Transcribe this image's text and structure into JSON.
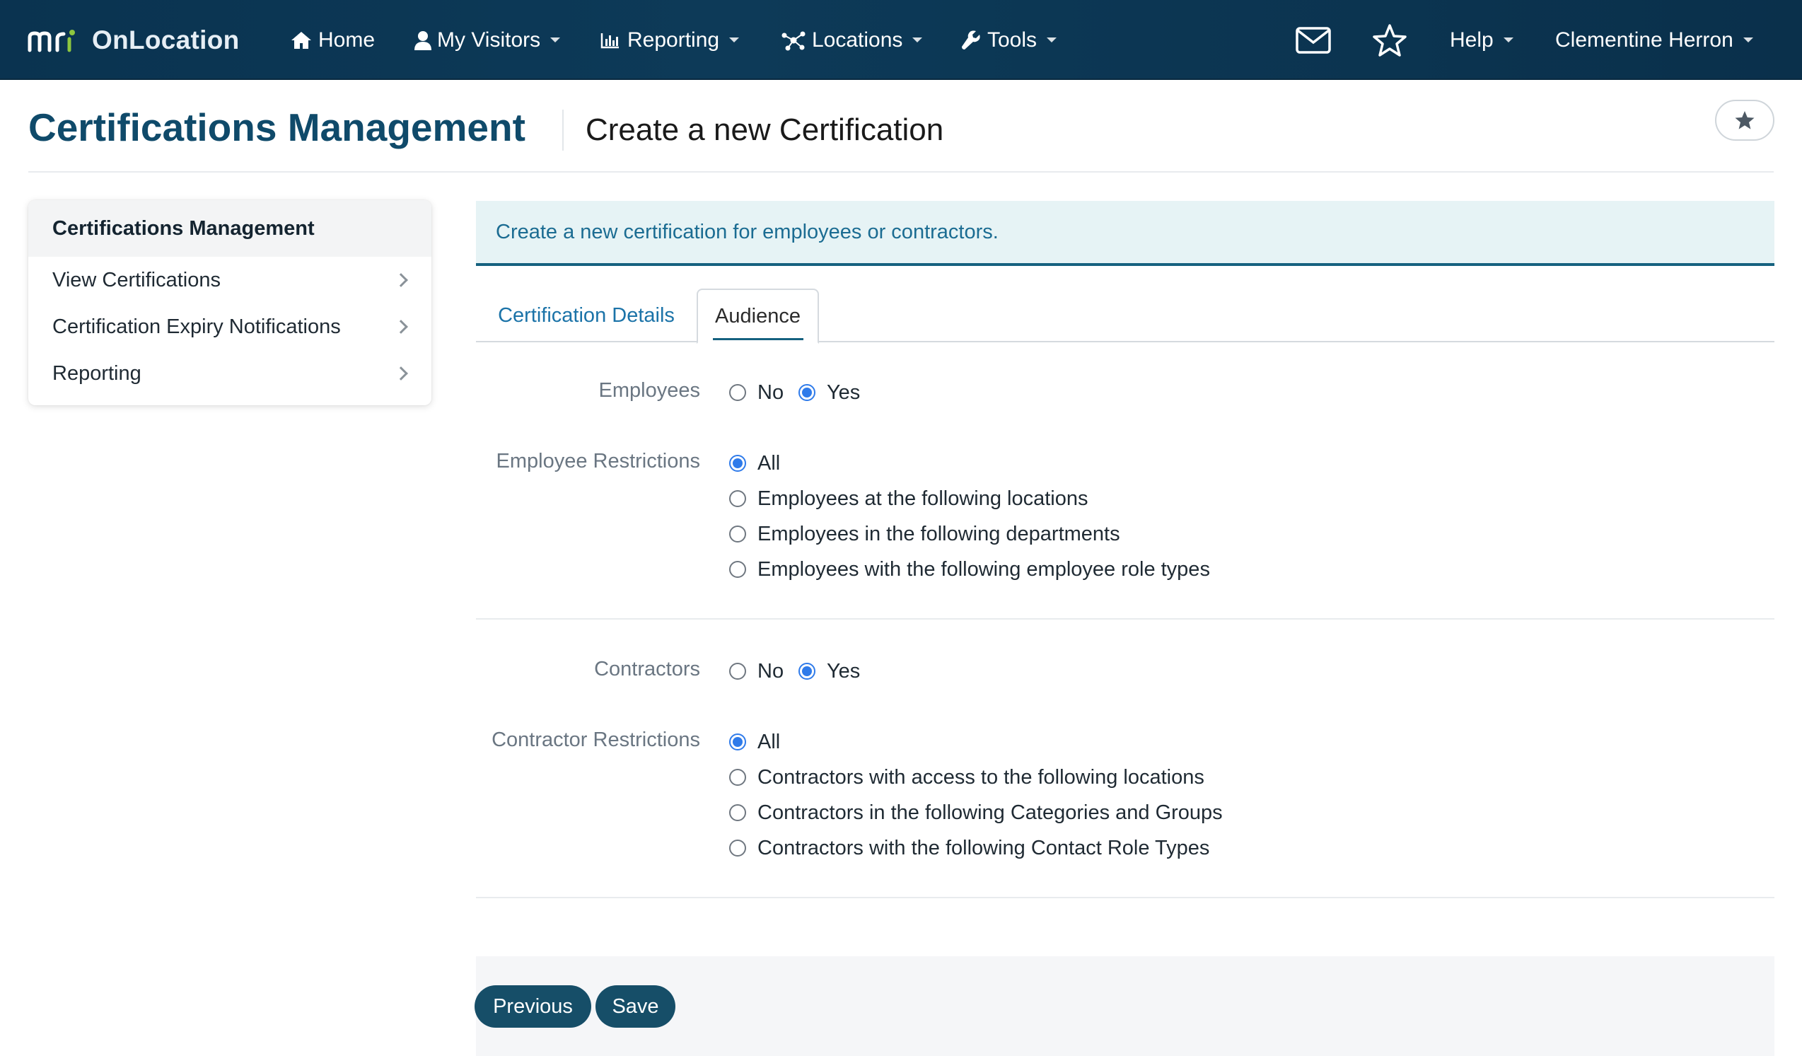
{
  "nav": {
    "brand": "OnLocation",
    "items": [
      {
        "label": "Home",
        "icon": "home-icon"
      },
      {
        "label": "My Visitors",
        "icon": "user-icon"
      },
      {
        "label": "Reporting",
        "icon": "bar-chart-icon"
      },
      {
        "label": "Locations",
        "icon": "network-icon"
      },
      {
        "label": "Tools",
        "icon": "wrench-icon"
      }
    ],
    "help": "Help",
    "user": "Clementine Herron"
  },
  "header": {
    "title": "Certifications Management",
    "subtitle": "Create a new Certification"
  },
  "sidebar": {
    "title": "Certifications Management",
    "items": [
      {
        "label": "View Certifications"
      },
      {
        "label": "Certification Expiry Notifications"
      },
      {
        "label": "Reporting"
      }
    ]
  },
  "banner": "Create a new certification for employees or contractors.",
  "tabs": [
    {
      "label": "Certification Details",
      "active": false
    },
    {
      "label": "Audience",
      "active": true
    }
  ],
  "form": {
    "employees": {
      "label": "Employees",
      "options": [
        {
          "label": "No",
          "checked": false
        },
        {
          "label": "Yes",
          "checked": true
        }
      ]
    },
    "employee_restrictions": {
      "label": "Employee Restrictions",
      "options": [
        {
          "label": "All",
          "checked": true
        },
        {
          "label": "Employees at the following locations",
          "checked": false
        },
        {
          "label": "Employees in the following departments",
          "checked": false
        },
        {
          "label": "Employees with the following employee role types",
          "checked": false
        }
      ]
    },
    "contractors": {
      "label": "Contractors",
      "options": [
        {
          "label": "No",
          "checked": false
        },
        {
          "label": "Yes",
          "checked": true
        }
      ]
    },
    "contractor_restrictions": {
      "label": "Contractor Restrictions",
      "options": [
        {
          "label": "All",
          "checked": true
        },
        {
          "label": "Contractors with access to the following locations",
          "checked": false
        },
        {
          "label": "Contractors in the following Categories and Groups",
          "checked": false
        },
        {
          "label": "Contractors with the following Contact Role Types",
          "checked": false
        }
      ]
    }
  },
  "buttons": {
    "previous": "Previous",
    "save": "Save"
  },
  "colors": {
    "navbar": "#0d3a58",
    "title": "#0f4a6a",
    "link": "#1b73a8",
    "radio_selected": "#2f7bea",
    "button": "#164e68",
    "banner_bg": "#e6f3f5"
  }
}
